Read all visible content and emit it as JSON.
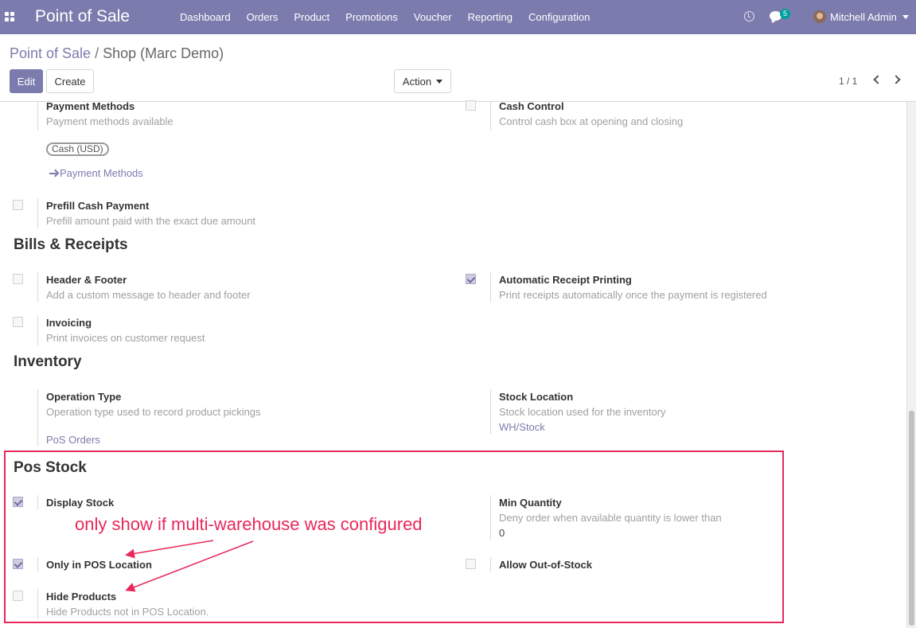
{
  "topbar": {
    "brand": "Point of Sale",
    "menu": [
      "Dashboard",
      "Orders",
      "Product",
      "Promotions",
      "Voucher",
      "Reporting",
      "Configuration"
    ],
    "chat_count": "5",
    "user_name": "Mitchell Admin",
    "color": "#7c7bad"
  },
  "breadcrumb": {
    "parent": "Point of Sale",
    "separator": "/",
    "current": "Shop (Marc Demo)"
  },
  "buttons": {
    "edit": "Edit",
    "create": "Create",
    "action": "Action"
  },
  "pager": {
    "value": "1 / 1"
  },
  "payment": {
    "title": "Payment Methods",
    "desc": "Payment methods available",
    "tag": "Cash (USD)",
    "link": "Payment Methods"
  },
  "cash_control": {
    "title": "Cash Control",
    "desc": "Control cash box at opening and closing",
    "checked": false
  },
  "prefill": {
    "title": "Prefill Cash Payment",
    "desc": "Prefill amount paid with the exact due amount",
    "checked": false
  },
  "bills": {
    "title": "Bills & Receipts",
    "header_footer": {
      "title": "Header & Footer",
      "desc": "Add a custom message to header and footer",
      "checked": false
    },
    "auto_print": {
      "title": "Automatic Receipt Printing",
      "desc": "Print receipts automatically once the payment is registered",
      "checked": true
    },
    "invoicing": {
      "title": "Invoicing",
      "desc": "Print invoices on customer request",
      "checked": false
    }
  },
  "inventory": {
    "title": "Inventory",
    "operation_type": {
      "title": "Operation Type",
      "desc": "Operation type used to record product pickings",
      "value": "PoS Orders"
    },
    "stock_location": {
      "title": "Stock Location",
      "desc": "Stock location used for the inventory",
      "value": "WH/Stock"
    }
  },
  "pos_stock": {
    "title": "Pos Stock",
    "display_stock": {
      "title": "Display Stock",
      "checked": true
    },
    "min_quantity": {
      "title": "Min Quantity",
      "desc": "Deny order when available quantity is lower than",
      "value": "0"
    },
    "only_pos_location": {
      "title": "Only in POS Location",
      "checked": true
    },
    "allow_out_of_stock": {
      "title": "Allow Out-of-Stock",
      "checked": false
    },
    "hide_products": {
      "title": "Hide Products",
      "desc": "Hide Products not in POS Location.",
      "checked": false
    }
  },
  "annotation": {
    "text": "only show if  multi-warehouse was configured",
    "color": "#e8285a"
  }
}
